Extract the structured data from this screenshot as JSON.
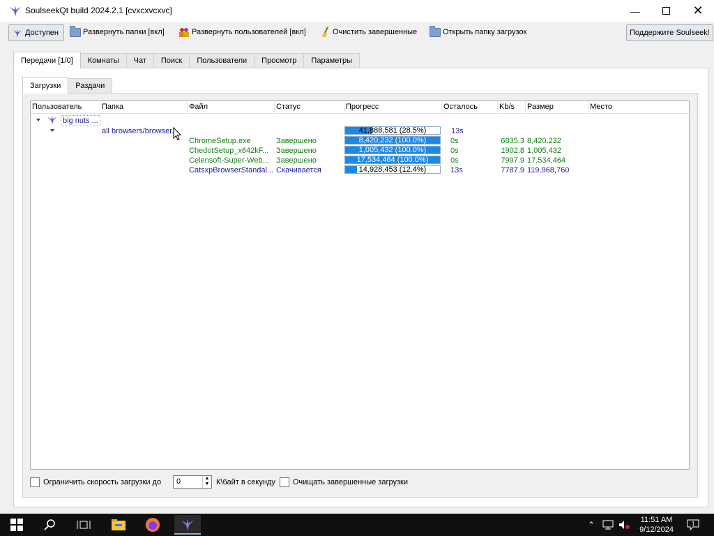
{
  "window": {
    "title": "SoulseekQt build 2024.2.1 [cvxcxvcxvc]"
  },
  "toolbar": {
    "status_label": "Доступен",
    "expand_folders_label": "Развернуть папки [вкл]",
    "expand_users_label": "Развернуть пользователей [вкл]",
    "clear_finished_label": "Очистить завершенные",
    "open_downloads_label": "Открыть папку загрузок",
    "support_label": "Поддержите Soulseek!"
  },
  "main_tabs": [
    "Передачи [1/0]",
    "Комнаты",
    "Чат",
    "Поиск",
    "Пользователи",
    "Просмотр",
    "Параметры"
  ],
  "sub_tabs": [
    "Загрузки",
    "Раздачи"
  ],
  "columns": [
    "Пользователь",
    "Папка",
    "Файл",
    "Статус",
    "Прогресс",
    "Осталось",
    "Kb/s",
    "Размер",
    "Место"
  ],
  "user_row": {
    "user": "big nuts ...",
    "progress_text": "41,888,581 (28.5%)",
    "progress": 0.285,
    "remaining": "13s"
  },
  "folder_row": {
    "folder": "all browsers/browser..."
  },
  "files": [
    {
      "file": "ChromeSetup.exe",
      "status": "Завершено",
      "progress_text": "8,420,232 (100.0%)",
      "progress": 1.0,
      "remaining": "0s",
      "speed": "6835.3",
      "size": "8,420,232",
      "state": "done"
    },
    {
      "file": "ChedotSetup_x642kF...",
      "status": "Завершено",
      "progress_text": "1,005,432 (100.0%)",
      "progress": 1.0,
      "remaining": "0s",
      "speed": "1902.8",
      "size": "1,005,432",
      "state": "done"
    },
    {
      "file": "Celensoft-Super-Web...",
      "status": "Завершено",
      "progress_text": "17,534,464 (100.0%)",
      "progress": 1.0,
      "remaining": "0s",
      "speed": "7997.9",
      "size": "17,534,464",
      "state": "done"
    },
    {
      "file": "CatsxpBrowserStandal...",
      "status": "Скачивается",
      "progress_text": "14,928,453 (12.4%)",
      "progress": 0.124,
      "remaining": "13s",
      "speed": "7787.9",
      "size": "119,968,760",
      "state": "active"
    }
  ],
  "bottom": {
    "limit_label": "Ограничить скорость загрузки до",
    "limit_value": "0",
    "unit_label": "К\\байт в секунду",
    "clear_label": "Очищать завершенные загрузки"
  },
  "taskbar": {
    "time": "11:51 AM",
    "date": "9/12/2024"
  },
  "colors": {
    "progress": "#1e88e5",
    "done": "#167d16",
    "active": "#1b1b9e",
    "desktop": "#0078d7"
  }
}
